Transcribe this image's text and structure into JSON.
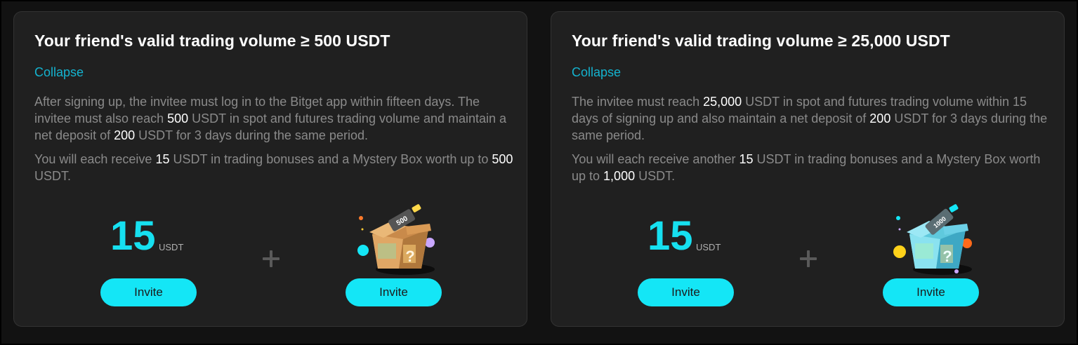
{
  "cards": [
    {
      "title": "Your friend's valid trading volume ≥ 500 USDT",
      "collapse_label": "Collapse",
      "p1": {
        "a": "After signing up, the invitee must log in to the Bitget app within fifteen days. The invitee must also reach ",
        "v1": "500",
        "b": " USDT in spot and futures trading volume and maintain a net deposit of ",
        "v2": "200",
        "c": " USDT for 3 days during the same period."
      },
      "p2": {
        "a": "You will each receive ",
        "v1": "15",
        "b": " USDT in trading bonuses and a Mystery Box worth up to ",
        "v2": "500",
        "c": " USDT."
      },
      "bonus_amount": "15",
      "bonus_unit": "USDT",
      "box_label": "500",
      "invite_left": "Invite",
      "invite_right": "Invite"
    },
    {
      "title": "Your friend's valid trading volume ≥ 25,000 USDT",
      "collapse_label": "Collapse",
      "p1": {
        "a": "The invitee must reach ",
        "v1": "25,000",
        "b": " USDT in spot and futures trading volume within 15 days of signing up and also maintain a net deposit of ",
        "v2": "200",
        "c": " USDT for 3 days during the same period."
      },
      "p2": {
        "a": "You will each receive another ",
        "v1": "15",
        "b": " USDT in trading bonuses and a Mystery Box worth up to ",
        "v2": "1,000",
        "c": " USDT."
      },
      "bonus_amount": "15",
      "bonus_unit": "USDT",
      "box_label": "1000",
      "invite_left": "Invite",
      "invite_right": "Invite"
    }
  ],
  "colors": {
    "accent": "#14e6f6",
    "link": "#14b3cf",
    "card_bg": "#202020",
    "page_bg": "#121212"
  },
  "icons": [
    "plus-icon",
    "mystery-box-500-icon",
    "mystery-box-1000-icon"
  ]
}
